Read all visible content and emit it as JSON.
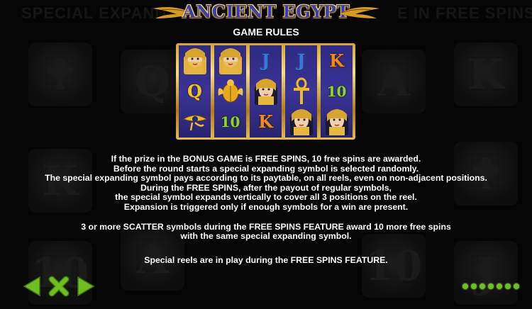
{
  "header": {
    "logo_text": "ANCIENT EGYPT",
    "subtitle": "GAME RULES"
  },
  "background": {
    "left_text": "SPECIAL EXPAND",
    "right_text": "E IN FREE SPINS"
  },
  "reels": [
    [
      "pharaoh-queen",
      "Q",
      "eye-of-horus"
    ],
    [
      "pharaoh-queen",
      "scarab",
      "10"
    ],
    [
      "J",
      "pharaoh-queen",
      "K"
    ],
    [
      "J",
      "ankh",
      "pharaoh-queen"
    ],
    [
      "K",
      "10",
      "pharaoh-queen"
    ]
  ],
  "rules_text": {
    "p1": [
      "If the prize in the BONUS GAME is FREE SPINS, 10 free spins are awarded.",
      "Before the round starts a special expanding symbol is selected randomly.",
      "The special expanding symbol pays according to its paytable, on all reels, even on non-adjacent positions.",
      "During the FREE SPINS, after the payout of regular symbols,",
      "the special symbol expands vertically to cover all 3 positions on the reel.",
      "Expansion is triggered only if enough symbols for a win are present."
    ],
    "p2": [
      "3 or more SCATTER symbols during the FREE SPINS FEATURE award 10 more free spins",
      "with the same special expanding symbol."
    ],
    "p3": [
      "Special reels are in play during the FREE SPINS FEATURE."
    ]
  },
  "navigation": {
    "prev_icon": "arrow-left-icon",
    "close_icon": "close-icon",
    "next_icon": "arrow-right-icon",
    "page_count": 7,
    "current_page": 1
  },
  "colors": {
    "accent_green": "#6fbe24",
    "reel_blue": "#2d2a82",
    "gold": "#e6b94a"
  }
}
